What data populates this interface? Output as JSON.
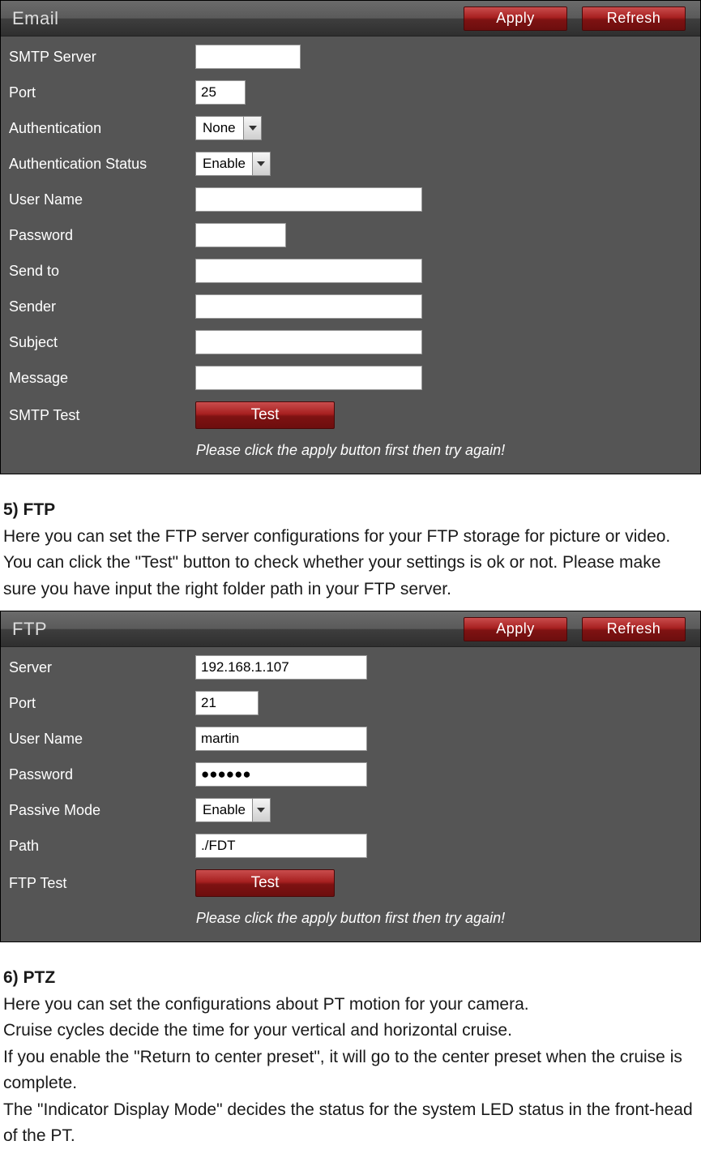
{
  "email_panel": {
    "title": "Email",
    "apply_label": "Apply",
    "refresh_label": "Refresh",
    "labels": {
      "smtp_server": "SMTP Server",
      "port": "Port",
      "authentication": "Authentication",
      "auth_status": "Authentication Status",
      "username": "User Name",
      "password": "Password",
      "send_to": "Send to",
      "sender": "Sender",
      "subject": "Subject",
      "message": "Message",
      "smtp_test": "SMTP Test"
    },
    "values": {
      "smtp_server": "",
      "port": "25",
      "authentication": "None",
      "auth_status": "Enable",
      "username": "",
      "password": "",
      "send_to": "",
      "sender": "",
      "subject": "",
      "message": ""
    },
    "test_label": "Test",
    "hint": "Please click the apply button first then try again!"
  },
  "ftp_section": {
    "heading": "5) FTP",
    "body": "Here you can set the FTP server configurations for your FTP storage for picture or video. You can click the \"Test\" button to check whether your settings is ok or not. Please make sure you have input the right folder path in your FTP server."
  },
  "ftp_panel": {
    "title": "FTP",
    "apply_label": "Apply",
    "refresh_label": "Refresh",
    "labels": {
      "server": "Server",
      "port": "Port",
      "username": "User Name",
      "password": "Password",
      "passive": "Passive Mode",
      "path": "Path",
      "ftp_test": "FTP Test"
    },
    "values": {
      "server": "192.168.1.107",
      "port": "21",
      "username": "martin",
      "password": "●●●●●●",
      "passive": "Enable",
      "path": "./FDT"
    },
    "test_label": "Test",
    "hint": "Please click the apply button first then try again!"
  },
  "ptz_section": {
    "heading": "6) PTZ",
    "line1": "Here you can set the configurations about PT motion for your camera.",
    "line2": "Cruise cycles decide the time for your vertical and horizontal cruise.",
    "line3": "If you enable the \"Return to center preset\", it will go to the center preset when the cruise is complete.",
    "line4": "The \"Indicator Display Mode\" decides the status for the system LED status in the front-head of the PT."
  }
}
